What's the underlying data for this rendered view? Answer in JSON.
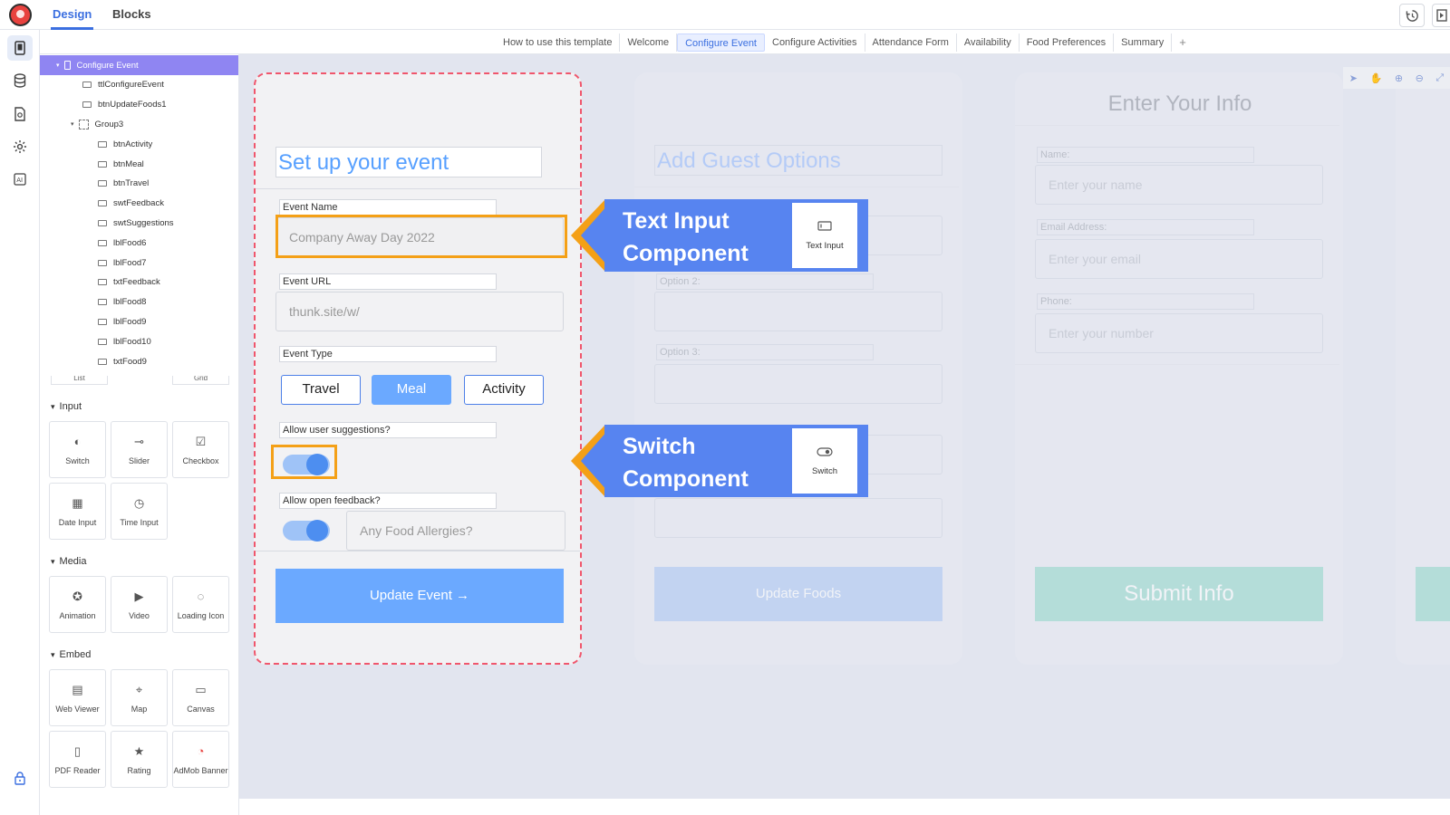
{
  "topbar": {
    "tabs": [
      "Design",
      "Blocks"
    ],
    "history_icon": "history-icon",
    "preview_icon": "preview-icon"
  },
  "page_tabs": [
    "How to use this template",
    "Welcome",
    "Configure Event",
    "Configure Activities",
    "Attendance Form",
    "Availability",
    "Food Preferences",
    "Summary"
  ],
  "page_tab_add": "+",
  "tree": [
    {
      "label": "Configure Event",
      "depth": 0,
      "selected": true,
      "icon": "screen-icon",
      "toggle": "▾"
    },
    {
      "label": "ttlConfigureEvent",
      "depth": 1,
      "icon": "title-component-icon"
    },
    {
      "label": "btnUpdateFoods1",
      "depth": 1,
      "icon": "button-component-icon"
    },
    {
      "label": "Group3",
      "depth": 1,
      "icon": "group-icon",
      "toggle": "▾"
    },
    {
      "label": "btnActivity",
      "depth": 2,
      "icon": "button-component-icon"
    },
    {
      "label": "btnMeal",
      "depth": 2,
      "icon": "button-component-icon"
    },
    {
      "label": "btnTravel",
      "depth": 2,
      "icon": "button-component-icon"
    },
    {
      "label": "swtFeedback",
      "depth": 2,
      "icon": "switch-component-icon"
    },
    {
      "label": "swtSuggestions",
      "depth": 2,
      "icon": "switch-component-icon"
    },
    {
      "label": "lblFood6",
      "depth": 2,
      "icon": "label-component-icon"
    },
    {
      "label": "lblFood7",
      "depth": 2,
      "icon": "label-component-icon"
    },
    {
      "label": "txtFeedback",
      "depth": 2,
      "icon": "text-input-component-icon"
    },
    {
      "label": "lblFood8",
      "depth": 2,
      "icon": "label-component-icon"
    },
    {
      "label": "lblFood9",
      "depth": 2,
      "icon": "label-component-icon"
    },
    {
      "label": "lblFood10",
      "depth": 2,
      "icon": "label-component-icon"
    },
    {
      "label": "txtFood9",
      "depth": 2,
      "icon": "text-input-component-icon"
    }
  ],
  "components": {
    "partial": [
      "List",
      "Grid"
    ],
    "sections": [
      {
        "title": "Input",
        "items": [
          {
            "label": "Switch",
            "icon": "switch-icon"
          },
          {
            "label": "Slider",
            "icon": "slider-icon"
          },
          {
            "label": "Checkbox",
            "icon": "checkbox-icon"
          },
          {
            "label": "Date Input",
            "icon": "calendar-icon"
          },
          {
            "label": "Time Input",
            "icon": "clock-icon"
          }
        ]
      },
      {
        "title": "Media",
        "items": [
          {
            "label": "Animation",
            "icon": "animation-icon"
          },
          {
            "label": "Video",
            "icon": "video-icon"
          },
          {
            "label": "Loading Icon",
            "icon": "spinner-icon"
          }
        ]
      },
      {
        "title": "Embed",
        "items": [
          {
            "label": "Web Viewer",
            "icon": "web-viewer-icon"
          },
          {
            "label": "Map",
            "icon": "map-icon"
          },
          {
            "label": "Canvas",
            "icon": "canvas-icon"
          },
          {
            "label": "PDF Reader",
            "icon": "pdf-icon"
          },
          {
            "label": "Rating",
            "icon": "rating-icon"
          },
          {
            "label": "AdMob Banner",
            "icon": "admob-icon"
          }
        ]
      }
    ]
  },
  "screen_main": {
    "title": "Set up your event",
    "event_name_label": "Event Name",
    "event_name_value": "Company Away Day 2022",
    "event_url_label": "Event URL",
    "event_url_value": "thunk.site/w/",
    "event_type_label": "Event Type",
    "event_types": [
      "Travel",
      "Meal",
      "Activity"
    ],
    "selected_type": "Meal",
    "suggestions_label": "Allow user suggestions?",
    "feedback_label": "Allow open feedback?",
    "food_allergies_placeholder": "Any Food Allergies?",
    "update_button": "Update Event →"
  },
  "screen_2": {
    "title": "Add Guest Options",
    "option2_label": "Option 2:",
    "option3_label": "Option 3:",
    "update_button": "Update Foods"
  },
  "screen_3": {
    "title": "Enter Your Info",
    "name_label": "Name:",
    "name_placeholder": "Enter your name",
    "email_label": "Email Address:",
    "email_placeholder": "Enter your email",
    "phone_label": "Phone:",
    "phone_placeholder": "Enter your number",
    "submit_button": "Submit Info"
  },
  "callouts": {
    "text_input": {
      "text": "Text Input Component",
      "card_label": "Text Input"
    },
    "switch": {
      "text": "Switch Component",
      "card_label": "Switch"
    }
  },
  "colors": {
    "accent": "#3b6fe0",
    "callout": "#5784f0",
    "highlight": "#f4a017",
    "button": "#6ba9ff",
    "submit": "#8fd8c8"
  }
}
